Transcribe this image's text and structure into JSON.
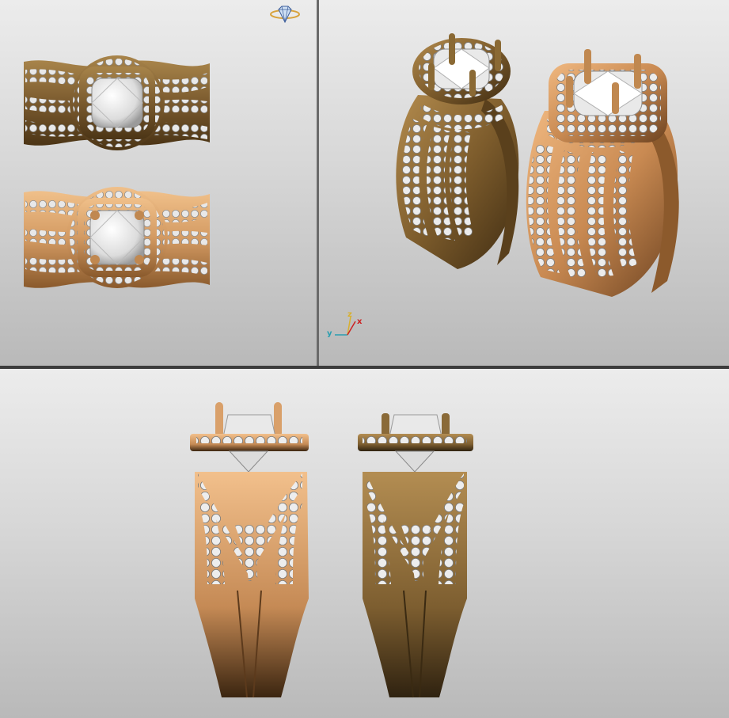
{
  "viewports": {
    "top_left": {
      "view": "top"
    },
    "top_right": {
      "view": "perspective"
    },
    "bottom": {
      "view": "front"
    }
  },
  "axis_widget": {
    "x_label": "x",
    "y_label": "y",
    "z_label": "z"
  },
  "colors": {
    "viewport_background_top": "#ececec",
    "viewport_background_bottom": "#b9b9b9",
    "gold_dark": "#8a6a38",
    "gold_light": "#d5a36c",
    "diamond": "#eeeeee",
    "axis_x": "#cc2222",
    "axis_y": "#2a9fb0",
    "axis_z": "#d8b030"
  },
  "icons": [
    "diamond-ring-icon",
    "axis-triad-icon"
  ]
}
